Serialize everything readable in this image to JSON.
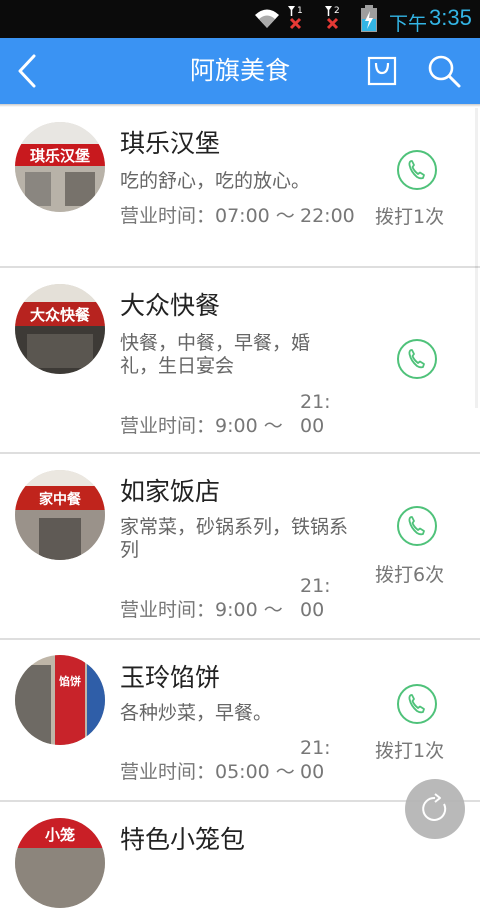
{
  "status_bar": {
    "sim1": "1",
    "sim2": "2",
    "ampm": "下午",
    "time": "3:35"
  },
  "header": {
    "title": "阿旗美食"
  },
  "shops": [
    {
      "name": "琪乐汉堡",
      "description": "吃的舒心，吃的放心。",
      "hours_open": "营业时间：07:00 ～",
      "hours_close": "22:00",
      "call_count": "拨打1次",
      "sign": "琪乐汉堡"
    },
    {
      "name": "大众快餐",
      "description": "快餐，中餐，早餐，婚礼，生日宴会",
      "hours_open": "营业时间：9:00 ～",
      "hours_close": "21:00",
      "call_count": "",
      "sign": "大众快餐"
    },
    {
      "name": "如家饭店",
      "description": "家常菜，砂锅系列，铁锅系列",
      "hours_open": "营业时间：9:00 ～",
      "hours_close": "21:00",
      "call_count": "拨打6次",
      "sign": "家中餐"
    },
    {
      "name": "玉玲馅饼",
      "description": "各种炒菜，早餐。",
      "hours_open": "营业时间：05:00 ～",
      "hours_close": "21:00",
      "call_count": "拨打1次",
      "sign": "馅饼"
    },
    {
      "name": "特色小笼包",
      "description": "",
      "hours_open": "",
      "hours_close": "",
      "call_count": "",
      "sign": "小笼"
    }
  ],
  "colors": {
    "header": "#3a93f3",
    "call_green": "#4fc27a",
    "status_accent": "#33b5e5"
  }
}
